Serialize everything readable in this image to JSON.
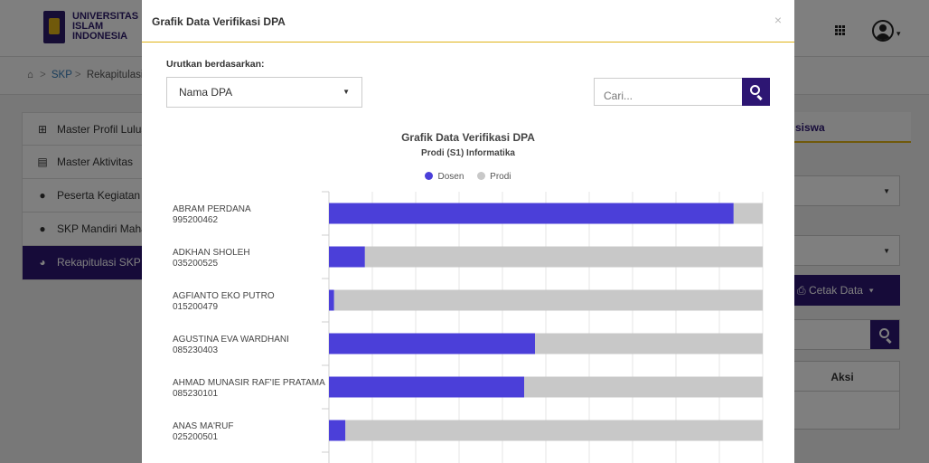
{
  "app": {
    "logo_lines": [
      "UNIVERSITAS",
      "ISLAM",
      "INDONESIA"
    ]
  },
  "breadcrumb": {
    "items": [
      "SKP",
      "Rekapitulasi SKP"
    ]
  },
  "sidebar": {
    "items": [
      {
        "label": "Master Profil Lulusan",
        "icon": "sitemap-icon"
      },
      {
        "label": "Master Aktivitas",
        "icon": "id-card-icon"
      },
      {
        "label": "Peserta Kegiatan Mahasiswa",
        "icon": "users-icon"
      },
      {
        "label": "SKP Mandiri Mahasiswa",
        "icon": "user-icon"
      },
      {
        "label": "Rekapitulasi SKP",
        "icon": "pie-chart-icon",
        "active": true
      }
    ]
  },
  "right_panel": {
    "tab_label": "siswa",
    "cetak_label": "Cetak Data",
    "aksi_label": "Aksi"
  },
  "modal": {
    "title": "Grafik Data Verifikasi DPA",
    "close_label": "×",
    "sort_label": "Urutkan berdasarkan:",
    "sort_value": "Nama DPA",
    "search_placeholder": "Cari..."
  },
  "colors": {
    "dosen": "#4b3fd9",
    "prodi": "#c8c8c8",
    "brand": "#2d1673",
    "accent": "#e0b316"
  },
  "chart_data": {
    "type": "bar",
    "orientation": "horizontal",
    "stacked": true,
    "title": "Grafik Data Verifikasi DPA",
    "subtitle": "Prodi (S1) Informatika",
    "legend": [
      "Dosen",
      "Prodi"
    ],
    "legend_position": "top",
    "xlim": [
      0,
      100
    ],
    "grid": true,
    "categories": [
      {
        "name": "ABRAM PERDANA",
        "id": "995200462"
      },
      {
        "name": "ADKHAN SHOLEH",
        "id": "035200525"
      },
      {
        "name": "AGFIANTO EKO PUTRO",
        "id": "015200479"
      },
      {
        "name": "AGUSTINA EVA WARDHANI",
        "id": "085230403"
      },
      {
        "name": "AHMAD MUNASIR RAF'IE PRATAMA",
        "id": "085230101"
      },
      {
        "name": "ANAS MA'RUF",
        "id": "025200501"
      }
    ],
    "series": [
      {
        "name": "Dosen",
        "values": [
          93.3,
          8.3,
          1.2,
          47.5,
          45.0,
          3.8
        ]
      },
      {
        "name": "Prodi",
        "values": [
          6.7,
          91.7,
          98.8,
          52.5,
          55.0,
          96.2
        ]
      }
    ]
  }
}
